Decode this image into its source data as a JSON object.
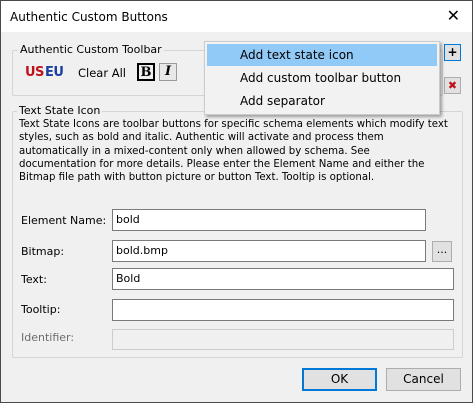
{
  "window": {
    "title": "Authentic Custom Buttons",
    "close_glyph": "✕"
  },
  "toolbar_group": {
    "label": "Authentic Custom Toolbar",
    "items": {
      "us": "US",
      "eu": "EU",
      "clear_all": "Clear All",
      "bold": "B",
      "italic": "I"
    },
    "add_glyph": "+",
    "delete_glyph": "✖"
  },
  "context_menu": {
    "items": [
      {
        "label": "Add text state icon",
        "highlighted": true
      },
      {
        "label": "Add custom toolbar button",
        "highlighted": false
      },
      {
        "label": "Add separator",
        "highlighted": false
      }
    ]
  },
  "text_state_group": {
    "label": "Text State Icon",
    "description": "Text State Icons are toolbar buttons for specific schema elements which modify text styles, such as bold and italic. Authentic will activate and process them automatically in a mixed-content only when allowed by schema. See documentation for more details. Please enter the Element Name and either the Bitmap file path with button picture or button Text. Tooltip is optional.",
    "fields": {
      "element_name": {
        "label": "Element Name:",
        "value": "bold"
      },
      "bitmap": {
        "label": "Bitmap:",
        "value": "bold.bmp",
        "browse_label": "..."
      },
      "text": {
        "label": "Text:",
        "value": "Bold"
      },
      "tooltip": {
        "label": "Tooltip:",
        "value": ""
      },
      "identifier": {
        "label": "Identifier:",
        "value": ""
      }
    }
  },
  "footer": {
    "ok_label": "OK",
    "cancel_label": "Cancel"
  },
  "colors": {
    "accent": "#0078d7",
    "menu_highlight": "#91c9f7",
    "us_red": "#c0111a",
    "eu_blue": "#1b3fa0"
  }
}
